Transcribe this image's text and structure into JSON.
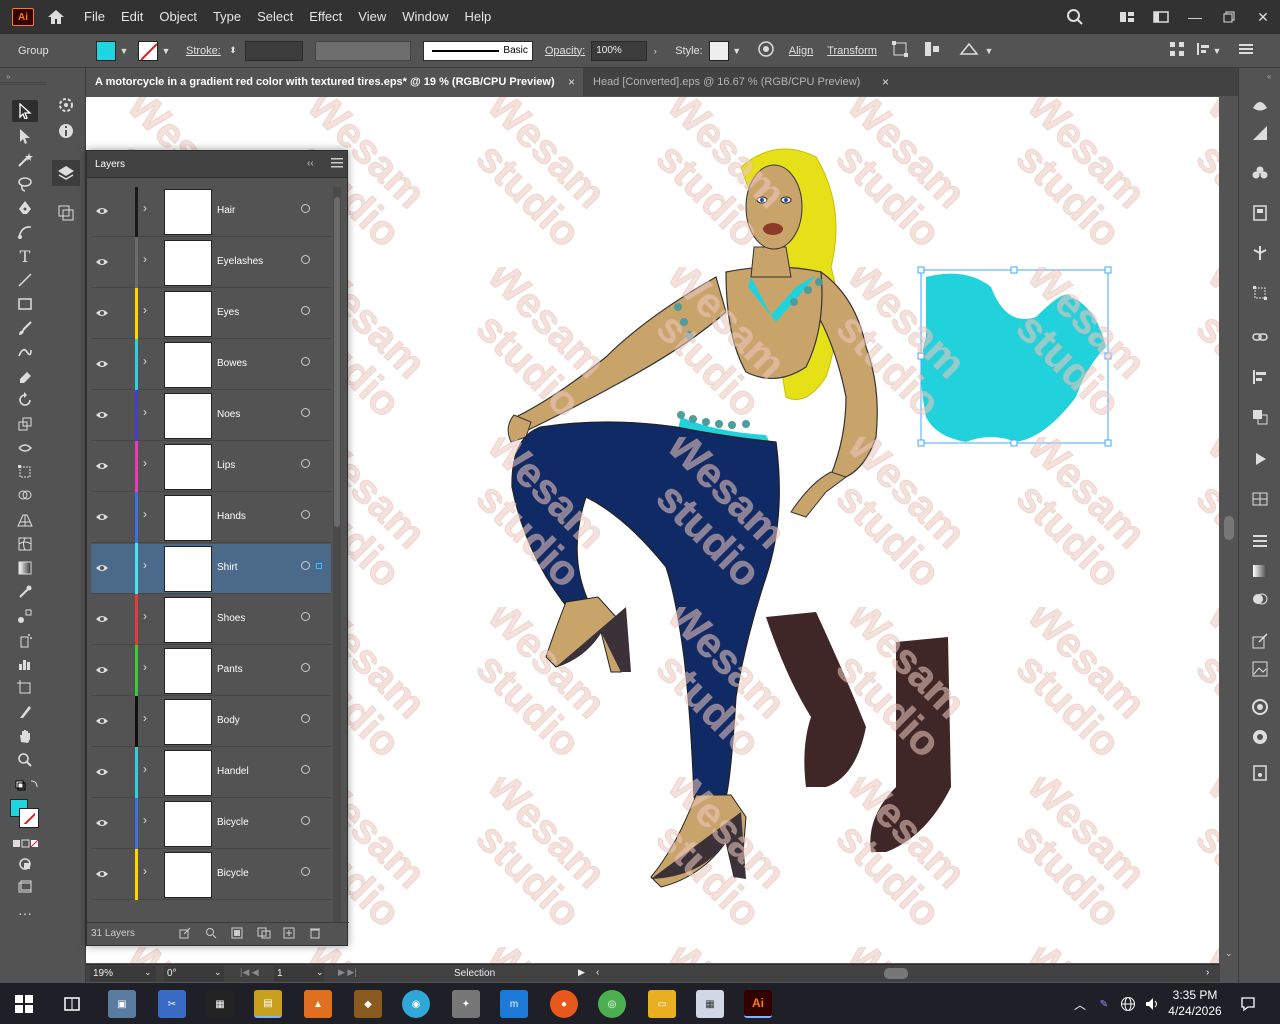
{
  "app": {
    "logo": "Ai"
  },
  "menu": [
    "File",
    "Edit",
    "Object",
    "Type",
    "Select",
    "Effect",
    "View",
    "Window",
    "Help"
  ],
  "control_bar": {
    "selection_type": "Group",
    "fill_color": "#1fd6e0",
    "stroke_label": "Stroke:",
    "brush_label": "Basic",
    "opacity_label": "Opacity:",
    "opacity_value": "100%",
    "style_label": "Style:",
    "align_label": "Align",
    "transform_label": "Transform"
  },
  "tabs": [
    {
      "title": "A motorcycle in a gradient red color with textured tires.eps* @ 19 % (RGB/CPU Preview)",
      "close": "×"
    },
    {
      "title": "Head [Converted].eps @ 16.67 % (RGB/CPU Preview)",
      "close": "×"
    }
  ],
  "layers_panel": {
    "title": "Layers",
    "count_label": "31 Layers",
    "layers": [
      {
        "name": "Hair",
        "color": "#1a1a1a"
      },
      {
        "name": "Eyelashes",
        "color": "#6b6b6b"
      },
      {
        "name": "Eyes",
        "color": "#ffd700"
      },
      {
        "name": "Bowes",
        "color": "#2fd0d8"
      },
      {
        "name": "Noes",
        "color": "#4a3ec8"
      },
      {
        "name": "Lips",
        "color": "#e63fb3"
      },
      {
        "name": "Hands",
        "color": "#3f6fd8"
      },
      {
        "name": "Shirt",
        "color": "#4fe3f0"
      },
      {
        "name": "Shoes",
        "color": "#e03b3b"
      },
      {
        "name": "Pants",
        "color": "#3ec83e"
      },
      {
        "name": "Body",
        "color": "#111111"
      },
      {
        "name": "Handel",
        "color": "#2fd0d8"
      },
      {
        "name": "Bicycle",
        "color": "#3f6fd8"
      },
      {
        "name": "Bicycle",
        "color": "#ffd700"
      }
    ],
    "selected_layer": "Shirt"
  },
  "status_bar": {
    "zoom": "19%",
    "rotation": "0°",
    "artboard": "1",
    "tool": "Selection"
  },
  "watermark": "Wesam studio",
  "taskbar": {
    "time": "3:35 PM",
    "date": "4/24/2026"
  }
}
